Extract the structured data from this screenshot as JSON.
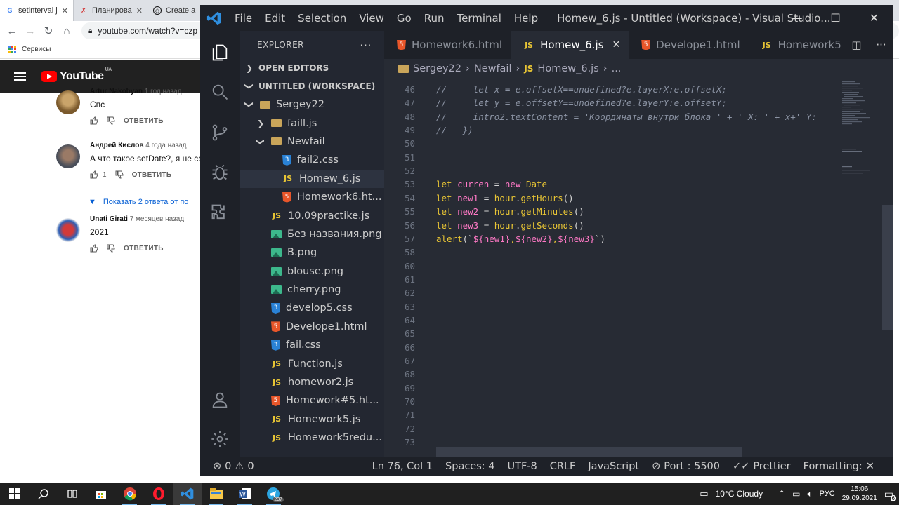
{
  "browser": {
    "tabs": [
      {
        "label": "setinterval j",
        "icon": "google-icon"
      },
      {
        "label": "Планирова",
        "icon": "scheduler-icon"
      },
      {
        "label": "Create a",
        "icon": "codepen-icon"
      }
    ],
    "url": "youtube.com/watch?v=czp",
    "bookmarks_label": "Сервисы"
  },
  "youtube": {
    "logo_text": "YouTube",
    "region": "UA",
    "comments": [
      {
        "author": "Artur Nakobyan",
        "time": "1 год назад",
        "text": "Спс",
        "likes": "",
        "reply_label": "ОТВЕТИТЬ"
      },
      {
        "author": "Андрей Кислов",
        "time": "4 года назад",
        "text": "А что такое setDate?, я не со",
        "likes": "1",
        "reply_label": "ОТВЕТИТЬ"
      },
      {
        "author": "Unati Girati",
        "time": "7 месяцев назад",
        "text": "2021",
        "likes": "",
        "reply_label": "ОТВЕТИТЬ"
      }
    ],
    "show_replies": "Показать 2 ответа от по"
  },
  "vscode": {
    "menu": [
      "File",
      "Edit",
      "Selection",
      "View",
      "Go",
      "Run",
      "Terminal",
      "Help"
    ],
    "window_title": "Homew_6.js - Untitled (Workspace) - Visual Studio...",
    "explorer_title": "EXPLORER",
    "sections": {
      "open_editors": "OPEN EDITORS",
      "workspace": "UNTITLED (WORKSPACE)"
    },
    "tree": [
      {
        "label": "Sergey22",
        "type": "folder-open",
        "indent": 1
      },
      {
        "label": "faill.js",
        "type": "folder",
        "indent": 2
      },
      {
        "label": "Newfail",
        "type": "folder-open",
        "indent": 2
      },
      {
        "label": "fail2.css",
        "type": "css",
        "indent": 3
      },
      {
        "label": "Homew_6.js",
        "type": "js",
        "indent": 3,
        "selected": true
      },
      {
        "label": "Homework6.ht...",
        "type": "html",
        "indent": 3
      },
      {
        "label": "10.09practike.js",
        "type": "js",
        "indent": 2
      },
      {
        "label": "Без названия.png",
        "type": "img",
        "indent": 2
      },
      {
        "label": "B.png",
        "type": "img",
        "indent": 2
      },
      {
        "label": "blouse.png",
        "type": "img",
        "indent": 2
      },
      {
        "label": "cherry.png",
        "type": "img",
        "indent": 2
      },
      {
        "label": "develop5.css",
        "type": "css",
        "indent": 2
      },
      {
        "label": "Develope1.html",
        "type": "html",
        "indent": 2
      },
      {
        "label": "fail.css",
        "type": "css",
        "indent": 2
      },
      {
        "label": "Function.js",
        "type": "js",
        "indent": 2
      },
      {
        "label": "homewor2.js",
        "type": "js",
        "indent": 2
      },
      {
        "label": "Homework#5.ht...",
        "type": "html",
        "indent": 2
      },
      {
        "label": "Homework5.js",
        "type": "js",
        "indent": 2
      },
      {
        "label": "Homework5redu...",
        "type": "js",
        "indent": 2
      }
    ],
    "editor_tabs": [
      {
        "label": "Homework6.html",
        "type": "html",
        "active": false
      },
      {
        "label": "Homew_6.js",
        "type": "js",
        "active": true
      },
      {
        "label": "Develope1.html",
        "type": "html",
        "active": false
      },
      {
        "label": "Homework5",
        "type": "js",
        "active": false
      }
    ],
    "breadcrumb": [
      "Sergey22",
      "Newfail",
      "Homew_6.js",
      "..."
    ],
    "code_lines": [
      {
        "n": "46",
        "text": "//     let x = e.offsetX==undefined?e.layerX:e.offsetX;",
        "kind": "comment"
      },
      {
        "n": "47",
        "text": "//     let y = e.offsetY==undefined?e.layerY:e.offsetY;",
        "kind": "comment"
      },
      {
        "n": "48",
        "text": "//     intro2.textContent = 'Координаты внутри блока ' + ' X: ' + x+' Y:",
        "kind": "comment"
      },
      {
        "n": "49",
        "text": "//   })",
        "kind": "comment"
      },
      {
        "n": "50",
        "text": "",
        "kind": "plain"
      },
      {
        "n": "51",
        "text": "",
        "kind": "plain"
      },
      {
        "n": "52",
        "text": "",
        "kind": "plain"
      },
      {
        "n": "53",
        "tokens": [
          [
            "kw",
            "let "
          ],
          [
            "vr",
            "curren"
          ],
          [
            "op",
            " = "
          ],
          [
            "vr",
            "new "
          ],
          [
            "fn",
            "Date"
          ]
        ]
      },
      {
        "n": "54",
        "tokens": [
          [
            "kw",
            "let "
          ],
          [
            "vr",
            "new1"
          ],
          [
            "op",
            " = "
          ],
          [
            "fn",
            "hour"
          ],
          [
            "op",
            "."
          ],
          [
            "fn",
            "getHours"
          ],
          [
            "op",
            "()"
          ]
        ]
      },
      {
        "n": "55",
        "tokens": [
          [
            "kw",
            "let "
          ],
          [
            "vr",
            "new2"
          ],
          [
            "op",
            " = "
          ],
          [
            "fn",
            "hour"
          ],
          [
            "op",
            "."
          ],
          [
            "fn",
            "getMinutes"
          ],
          [
            "op",
            "()"
          ]
        ]
      },
      {
        "n": "56",
        "tokens": [
          [
            "kw",
            "let "
          ],
          [
            "vr",
            "new3"
          ],
          [
            "op",
            " = "
          ],
          [
            "fn",
            "hour"
          ],
          [
            "op",
            "."
          ],
          [
            "fn",
            "getSeconds"
          ],
          [
            "op",
            "()"
          ]
        ]
      },
      {
        "n": "57",
        "tokens": [
          [
            "fn",
            "alert"
          ],
          [
            "op",
            "(`"
          ],
          [
            "tp",
            "${new1}"
          ],
          [
            "st",
            ","
          ],
          [
            "tp",
            "${new2}"
          ],
          [
            "st",
            ","
          ],
          [
            "tp",
            "${new3}"
          ],
          [
            "op",
            "`)"
          ]
        ]
      },
      {
        "n": "58",
        "text": "",
        "kind": "plain"
      },
      {
        "n": "60",
        "text": "",
        "kind": "plain"
      },
      {
        "n": "61",
        "text": "",
        "kind": "plain"
      },
      {
        "n": "62",
        "text": "",
        "kind": "plain"
      },
      {
        "n": "63",
        "text": "",
        "kind": "plain"
      },
      {
        "n": "64",
        "text": "",
        "kind": "plain"
      },
      {
        "n": "65",
        "text": "",
        "kind": "plain"
      },
      {
        "n": "66",
        "text": "",
        "kind": "plain"
      },
      {
        "n": "67",
        "text": "",
        "kind": "plain"
      },
      {
        "n": "68",
        "text": "",
        "kind": "plain"
      },
      {
        "n": "69",
        "text": "",
        "kind": "plain"
      },
      {
        "n": "70",
        "text": "",
        "kind": "plain"
      },
      {
        "n": "71",
        "text": "",
        "kind": "plain"
      },
      {
        "n": "72",
        "text": "",
        "kind": "plain"
      },
      {
        "n": "73",
        "text": "",
        "kind": "plain"
      }
    ],
    "status": {
      "errors": "0",
      "warnings": "0",
      "position": "Ln 76, Col 1",
      "spaces": "Spaces: 4",
      "encoding": "UTF-8",
      "eol": "CRLF",
      "language": "JavaScript",
      "port": "Port : 5500",
      "prettier": "Prettier",
      "formatting": "Formatting:"
    }
  },
  "taskbar": {
    "apps": [
      "start-icon",
      "search-icon",
      "task-view-icon",
      "store-icon",
      "chrome-icon",
      "opera-icon",
      "vscode-icon",
      "explorer-icon",
      "word-icon",
      "telegram-icon"
    ],
    "weather": "10°C  Cloudy",
    "lang": "РУС",
    "time": "15:06",
    "date": "29.09.2021",
    "telegram_badge": "237",
    "notif_count": "6"
  },
  "colors": {
    "accent": "#e8c535",
    "keyword": "#e8c535",
    "variable": "#ff79c6",
    "comment": "#8b93a3",
    "vscode_bg": "#272b34"
  }
}
